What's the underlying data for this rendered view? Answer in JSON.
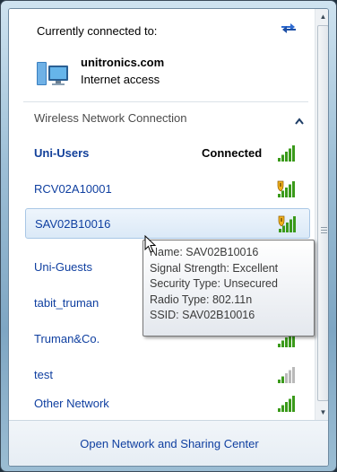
{
  "header": {
    "title": "Currently connected to:",
    "connection_name": "unitronics.com",
    "connection_status": "Internet access",
    "refresh_icon": "refresh-icon",
    "network_icon": "network-icon"
  },
  "section": {
    "label": "Wireless Network Connection",
    "collapse_icon": "chevron-up-icon"
  },
  "networks": [
    {
      "name": "Uni-Users",
      "status": "Connected",
      "secured": true,
      "shield": false,
      "strength": 5
    },
    {
      "name": "RCV02A10001",
      "status": "",
      "shield": true,
      "strength": 5
    },
    {
      "name": "SAV02B10016",
      "status": "",
      "shield": true,
      "strength": 5,
      "selected": true
    },
    {
      "name": "Uni-Guests",
      "status": "",
      "shield": false,
      "strength": 5
    },
    {
      "name": "tabit_truman",
      "status": "",
      "shield": false,
      "strength": 5
    },
    {
      "name": "Truman&Co.",
      "status": "",
      "shield": false,
      "strength": 5
    },
    {
      "name": "test",
      "status": "",
      "shield": false,
      "strength": 2
    },
    {
      "name": "Other Network",
      "status": "",
      "shield": false,
      "strength": 5
    }
  ],
  "tooltip": {
    "name": "Name: SAV02B10016",
    "signal": "Signal Strength: Excellent",
    "security": "Security Type: Unsecured",
    "radio": "Radio Type: 802.11n",
    "ssid": "SSID: SAV02B10016"
  },
  "footer": {
    "link": "Open Network and Sharing Center"
  },
  "colors": {
    "link": "#0f3fa0",
    "signal_on": "#3a9a1a",
    "signal_off": "#b9b9b9",
    "selection": "#dbe9f7"
  }
}
